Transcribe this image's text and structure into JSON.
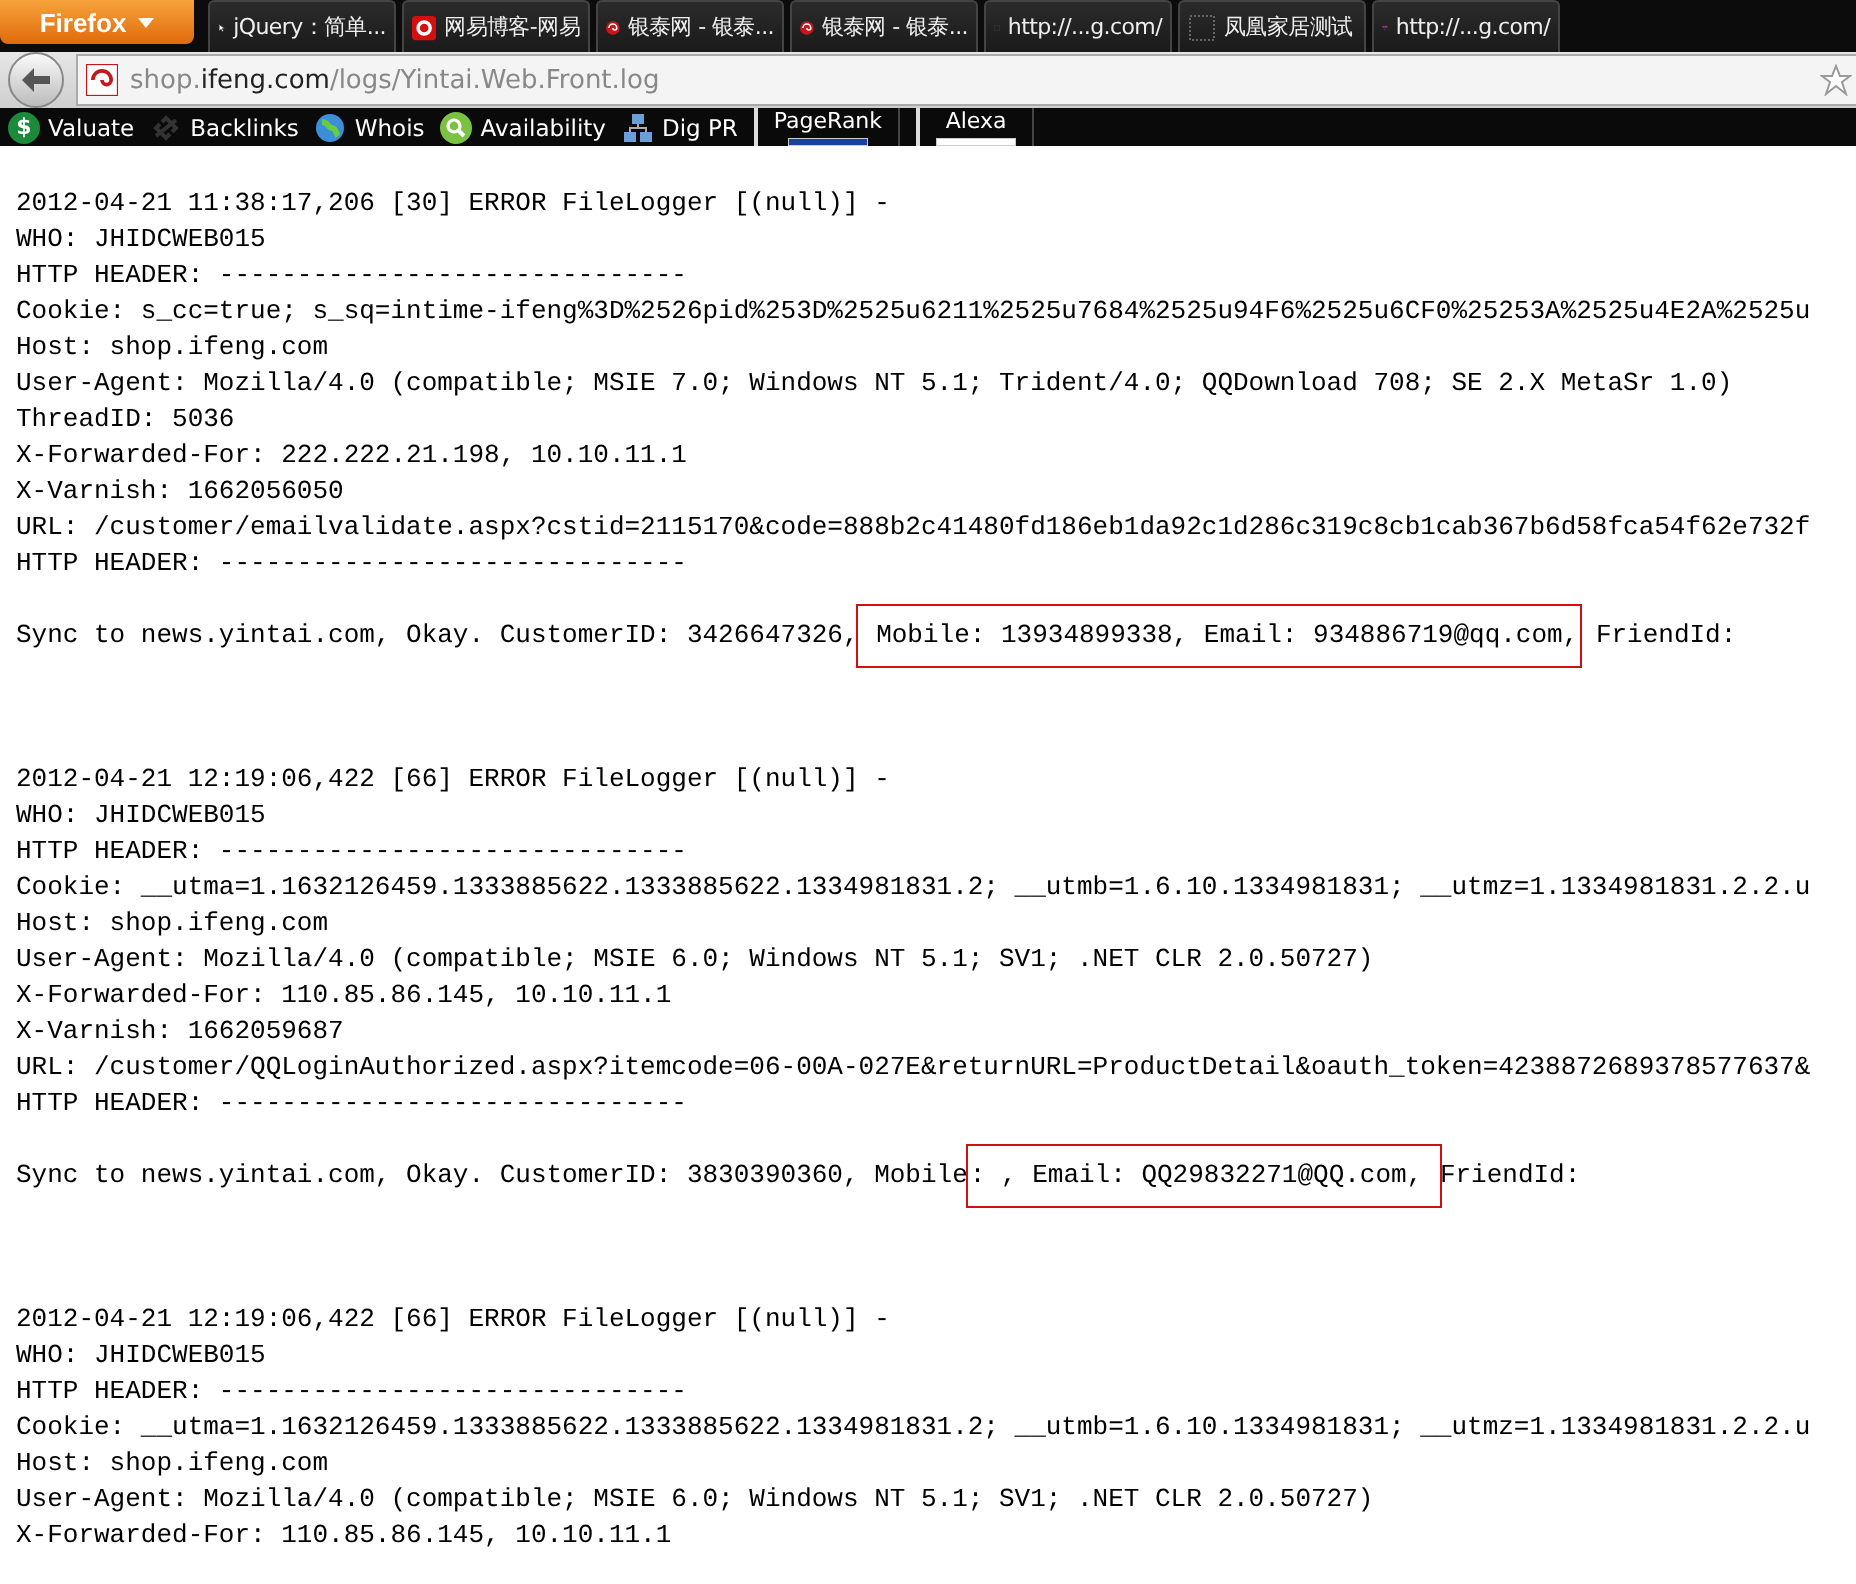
{
  "browser_button": "Firefox",
  "tabs": [
    {
      "label": "jQuery：简单...",
      "kind": "cursor"
    },
    {
      "label": "网易博客-网易",
      "kind": "netease"
    },
    {
      "label": "银泰网 - 银泰...",
      "kind": "swirl"
    },
    {
      "label": "银泰网 - 银泰...",
      "kind": "swirl"
    },
    {
      "label": "http://...g.com/",
      "kind": "blank"
    },
    {
      "label": "凤凰家居测试",
      "kind": "blank"
    },
    {
      "label": "http://...g.com/",
      "kind": "flag"
    }
  ],
  "address": {
    "host_prefix": "shop.",
    "host_domain": "ifeng.com",
    "path": "/logs/Yintai.Web.Front.log"
  },
  "bookmarks": [
    {
      "label": "Valuate",
      "kind": "dollar",
      "icon_text": "$"
    },
    {
      "label": "Backlinks",
      "kind": "links"
    },
    {
      "label": "Whois",
      "kind": "globe"
    },
    {
      "label": "Availability",
      "kind": "search"
    },
    {
      "label": "Dig PR",
      "kind": "network"
    },
    {
      "label": "PageRank",
      "kind": "meter"
    },
    {
      "label": "Alexa",
      "kind": "meter"
    }
  ],
  "log_entries": [
    {
      "lines": [
        "2012-04-21 11:38:17,206 [30] ERROR FileLogger [(null)] -",
        "WHO: JHIDCWEB015",
        "HTTP HEADER: ------------------------------",
        "Cookie: s_cc=true; s_sq=intime-ifeng%3D%2526pid%253D%2525u6211%2525u7684%2525u94F6%2525u6CF0%25253A%2525u4E2A%2525u",
        "Host: shop.ifeng.com",
        "User-Agent: Mozilla/4.0 (compatible; MSIE 7.0; Windows NT 5.1; Trident/4.0; QQDownload 708; SE 2.X MetaSr 1.0)",
        "ThreadID: 5036",
        "X-Forwarded-For: 222.222.21.198, 10.10.11.1",
        "X-Varnish: 1662056050",
        "URL: /customer/emailvalidate.aspx?cstid=2115170&code=888b2c41480fd186eb1da92c1d286c319c8cb1cab367b6d58fca54f62e732f",
        "HTTP HEADER: ------------------------------"
      ],
      "sync": [
        {
          "text": "Sync to news.yintai.com, Okay. CustomerID: 3426647326,",
          "highlighted": false
        },
        {
          "text": " Mobile: 13934899338, Email: 934886719@qq.com,",
          "highlighted": true
        },
        {
          "text": " FriendId:",
          "highlighted": false
        }
      ]
    },
    {
      "lines": [
        "2012-04-21 12:19:06,422 [66] ERROR FileLogger [(null)] -",
        "WHO: JHIDCWEB015",
        "HTTP HEADER: ------------------------------",
        "Cookie: __utma=1.1632126459.1333885622.1333885622.1334981831.2; __utmb=1.6.10.1334981831; __utmz=1.1334981831.2.2.u",
        "Host: shop.ifeng.com",
        "User-Agent: Mozilla/4.0 (compatible; MSIE 6.0; Windows NT 5.1; SV1; .NET CLR 2.0.50727)",
        "X-Forwarded-For: 110.85.86.145, 10.10.11.1",
        "X-Varnish: 1662059687",
        "URL: /customer/QQLoginAuthorized.aspx?itemcode=06-00A-027E&returnURL=ProductDetail&oauth_token=4238872689378577637&",
        "HTTP HEADER: ------------------------------"
      ],
      "sync": [
        {
          "text": "Sync to news.yintai.com, Okay. CustomerID: 3830390360, Mobile",
          "highlighted": false
        },
        {
          "text": ": , Email: QQ29832271@QQ.com, ",
          "highlighted": true
        },
        {
          "text": "FriendId:",
          "highlighted": false
        }
      ]
    },
    {
      "lines": [
        "2012-04-21 12:19:06,422 [66] ERROR FileLogger [(null)] -",
        "WHO: JHIDCWEB015",
        "HTTP HEADER: ------------------------------",
        "Cookie: __utma=1.1632126459.1333885622.1333885622.1334981831.2; __utmb=1.6.10.1334981831; __utmz=1.1334981831.2.2.u",
        "Host: shop.ifeng.com",
        "User-Agent: Mozilla/4.0 (compatible; MSIE 6.0; Windows NT 5.1; SV1; .NET CLR 2.0.50727)",
        "X-Forwarded-For: 110.85.86.145, 10.10.11.1"
      ]
    }
  ]
}
